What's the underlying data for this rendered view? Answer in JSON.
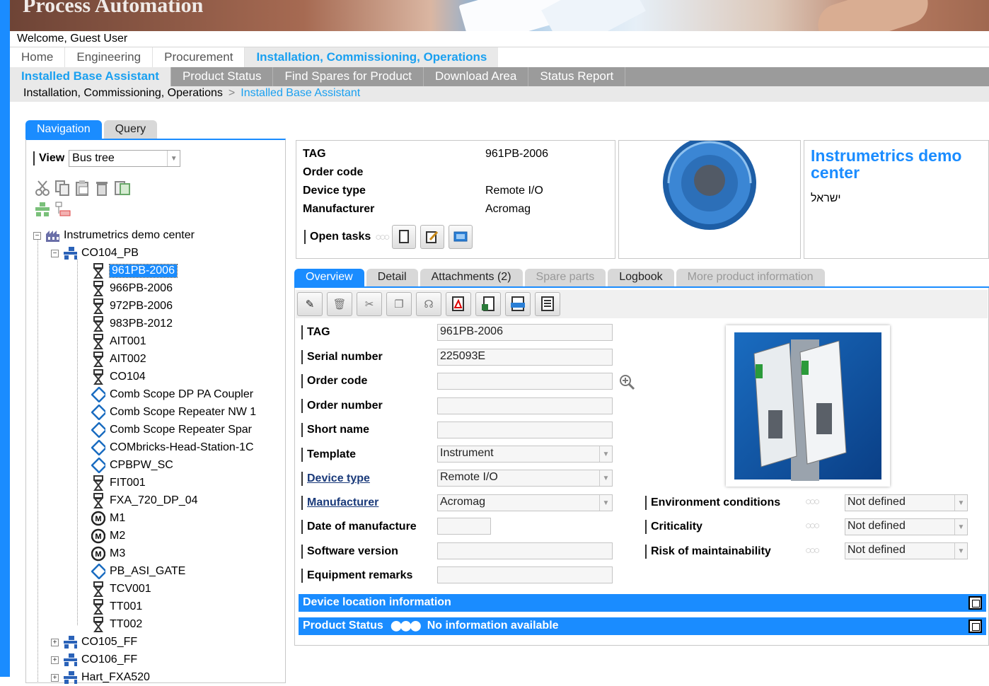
{
  "app_title": "Process Automation",
  "welcome": "Welcome, Guest User",
  "main_tabs": [
    "Home",
    "Engineering",
    "Procurement",
    "Installation, Commissioning, Operations"
  ],
  "sub_tabs": [
    "Installed Base Assistant",
    "Product Status",
    "Find Spares for Product",
    "Download Area",
    "Status Report"
  ],
  "breadcrumb": {
    "parent": "Installation, Commissioning, Operations",
    "separator": ">",
    "current": "Installed Base Assistant"
  },
  "nav_tabs": {
    "navigation": "Navigation",
    "query": "Query"
  },
  "view": {
    "label": "View",
    "value": "Bus tree"
  },
  "tree": {
    "root": "Instrumetrics demo center",
    "segment": "CO104_PB",
    "children": [
      "961PB-2006",
      "966PB-2006",
      "972PB-2006",
      "983PB-2012",
      "AIT001",
      "AIT002",
      "CO104",
      "Comb Scope DP PA Coupler",
      "Comb Scope Repeater NW 1",
      "Comb Scope Repeater Spar",
      "COMbricks-Head-Station-1C",
      "CPBPW_SC",
      "FIT001",
      "FXA_720_DP_04",
      "M1",
      "M2",
      "M3",
      "PB_ASI_GATE",
      "TCV001",
      "TT001",
      "TT002"
    ],
    "others": [
      "CO105_FF",
      "CO106_FF",
      "Hart_FXA520"
    ]
  },
  "summary": {
    "tag_label": "TAG",
    "tag_value": "961PB-2006",
    "order_code_label": "Order code",
    "device_type_label": "Device type",
    "device_type_value": "Remote I/O",
    "manufacturer_label": "Manufacturer",
    "manufacturer_value": "Acromag",
    "open_tasks_label": "Open tasks"
  },
  "org": {
    "name": "Instrumetrics demo center",
    "sub": "ישראל"
  },
  "detail_tabs": [
    "Overview",
    "Detail",
    "Attachments (2)",
    "Spare parts",
    "Logbook",
    "More product information"
  ],
  "fields": {
    "tag": {
      "label": "TAG",
      "value": "961PB-2006"
    },
    "serial": {
      "label": "Serial number",
      "value": "225093E"
    },
    "order_code": {
      "label": "Order code",
      "value": ""
    },
    "order_number": {
      "label": "Order number",
      "value": ""
    },
    "short_name": {
      "label": "Short name",
      "value": ""
    },
    "template": {
      "label": "Template",
      "value": "Instrument"
    },
    "device_type": {
      "label": "Device type",
      "value": "Remote I/O"
    },
    "manufacturer": {
      "label": "Manufacturer",
      "value": "Acromag"
    },
    "date_manufacture": {
      "label": "Date of manufacture",
      "value": ""
    },
    "software": {
      "label": "Software version",
      "value": ""
    },
    "remarks": {
      "label": "Equipment remarks",
      "value": ""
    }
  },
  "conditions": {
    "env": {
      "label": "Environment conditions",
      "value": "Not defined"
    },
    "criticality": {
      "label": "Criticality",
      "value": "Not defined"
    },
    "risk": {
      "label": "Risk of maintainability",
      "value": "Not defined"
    }
  },
  "sections": {
    "location": "Device location information",
    "status_label": "Product Status",
    "status_value": "No information available"
  },
  "colors": {
    "accent": "#1a8cff",
    "tab_gray": "#9b9b9b"
  }
}
